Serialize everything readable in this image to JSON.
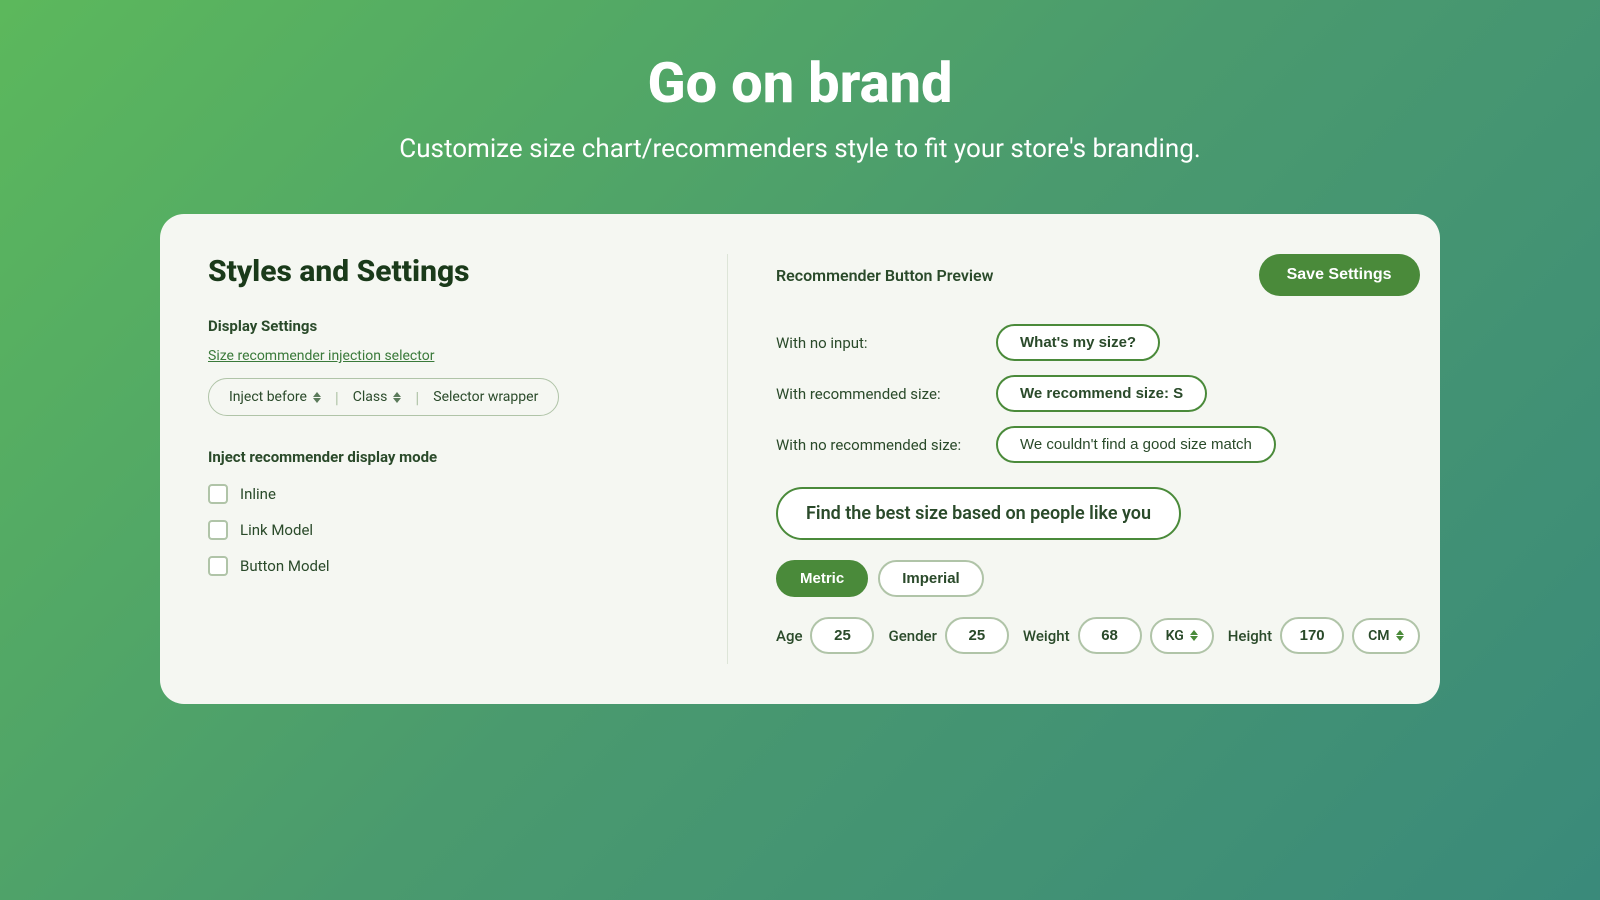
{
  "page": {
    "title": "Go on brand",
    "subtitle": "Customize size chart/recommenders style to fit your store's branding."
  },
  "left_panel": {
    "section_title": "Styles and Settings",
    "display_settings_label": "Display Settings",
    "injection_selector_link": "Size recommender injection selector",
    "selector": {
      "inject_before": "Inject before",
      "class": "Class",
      "selector_wrapper": "Selector wrapper"
    },
    "inject_mode_label": "Inject recommender display mode",
    "checkboxes": [
      {
        "label": "Inline"
      },
      {
        "label": "Link Model"
      },
      {
        "label": "Button Model"
      }
    ]
  },
  "right_panel": {
    "preview_title": "Recommender Button Preview",
    "save_btn": "Save Settings",
    "rows": [
      {
        "label": "With no input:",
        "btn_text": "What's my size?"
      },
      {
        "label": "With recommended size:",
        "btn_text": "We recommend size: S"
      },
      {
        "label": "With no recommended size:",
        "btn_text": "We couldn't find a good size match"
      }
    ],
    "recommender_text": "Find the best size based on people like you",
    "units": [
      {
        "label": "Metric",
        "active": true
      },
      {
        "label": "Imperial",
        "active": false
      }
    ],
    "measurements": [
      {
        "label": "Age",
        "value": "25",
        "unit": null
      },
      {
        "label": "Gender",
        "value": "25",
        "unit": null
      },
      {
        "label": "Weight",
        "value": "68",
        "unit": "KG"
      },
      {
        "label": "Height",
        "value": "170",
        "unit": "CM"
      }
    ]
  }
}
